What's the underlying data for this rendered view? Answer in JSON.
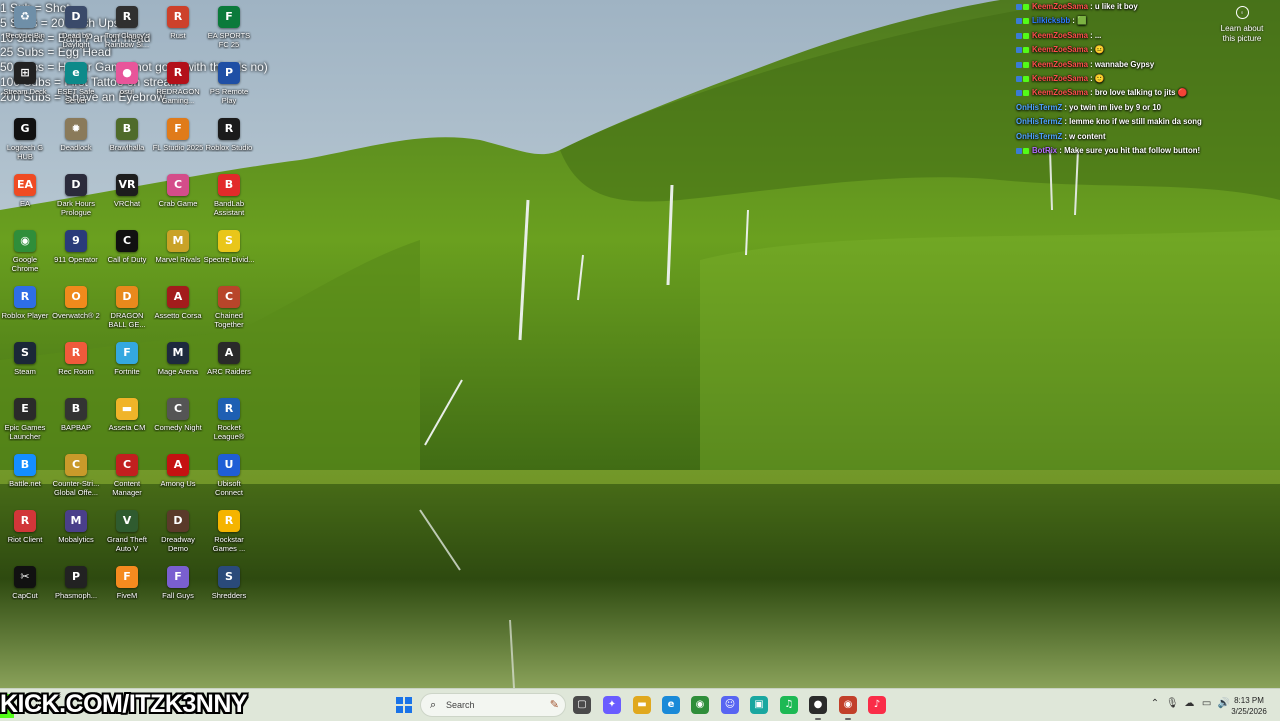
{
  "desktop_icons": [
    {
      "label": "Recycle Bin",
      "glyph": "♻",
      "color": "#6f8fa8",
      "col": 0,
      "row": 0
    },
    {
      "label": "Dead by Daylight",
      "glyph": "D",
      "color": "#3a4a6a",
      "col": 1,
      "row": 0
    },
    {
      "label": "Tom Clancy's Rainbow Si...",
      "glyph": "R",
      "color": "#303030",
      "col": 2,
      "row": 0
    },
    {
      "label": "Rust",
      "glyph": "R",
      "color": "#cd412b",
      "col": 3,
      "row": 0
    },
    {
      "label": "EA SPORTS FC 25",
      "glyph": "F",
      "color": "#0b7a3b",
      "col": 4,
      "row": 0
    },
    {
      "label": "Stream Deck",
      "glyph": "⊞",
      "color": "#222222",
      "col": 0,
      "row": 1
    },
    {
      "label": "ESET Safe Server",
      "glyph": "e",
      "color": "#0d8a8a",
      "col": 1,
      "row": 1
    },
    {
      "label": "osu!",
      "glyph": "●",
      "color": "#e8559a",
      "col": 2,
      "row": 1
    },
    {
      "label": "REDRAGON Gaming...",
      "glyph": "R",
      "color": "#b3101a",
      "col": 3,
      "row": 1
    },
    {
      "label": "PS Remote Play",
      "glyph": "P",
      "color": "#1f4fa5",
      "col": 4,
      "row": 1
    },
    {
      "label": "Logitech G HUB",
      "glyph": "G",
      "color": "#111111",
      "col": 0,
      "row": 2
    },
    {
      "label": "Deadlock",
      "glyph": "✹",
      "color": "#8a7a5a",
      "col": 1,
      "row": 2
    },
    {
      "label": "Brawlhalla",
      "glyph": "B",
      "color": "#4f6b2a",
      "col": 2,
      "row": 2
    },
    {
      "label": "FL Studio 2025",
      "glyph": "F",
      "color": "#e07b1a",
      "col": 3,
      "row": 2
    },
    {
      "label": "Roblox Studio",
      "glyph": "R",
      "color": "#1b1b1b",
      "col": 4,
      "row": 2
    },
    {
      "label": "EA",
      "glyph": "EA",
      "color": "#ef4b23",
      "col": 0,
      "row": 3
    },
    {
      "label": "Dark Hours Prologue",
      "glyph": "D",
      "color": "#2b2b3b",
      "col": 1,
      "row": 3
    },
    {
      "label": "VRChat",
      "glyph": "VR",
      "color": "#1d1d1d",
      "col": 2,
      "row": 3
    },
    {
      "label": "Crab Game",
      "glyph": "C",
      "color": "#d44d8a",
      "col": 3,
      "row": 3
    },
    {
      "label": "BandLab Assistant",
      "glyph": "B",
      "color": "#e22a2a",
      "col": 4,
      "row": 3
    },
    {
      "label": "Google Chrome",
      "glyph": "◉",
      "color": "#2f8e3a",
      "col": 0,
      "row": 4
    },
    {
      "label": "911 Operator",
      "glyph": "9",
      "color": "#2a3b7a",
      "col": 1,
      "row": 4
    },
    {
      "label": "Call of Duty",
      "glyph": "C",
      "color": "#111111",
      "col": 2,
      "row": 4
    },
    {
      "label": "Marvel Rivals",
      "glyph": "M",
      "color": "#c9a227",
      "col": 3,
      "row": 4
    },
    {
      "label": "Spectre Divid...",
      "glyph": "S",
      "color": "#e9c61a",
      "col": 4,
      "row": 4
    },
    {
      "label": "Roblox Player",
      "glyph": "R",
      "color": "#2e6ee6",
      "col": 0,
      "row": 5
    },
    {
      "label": "Overwatch® 2",
      "glyph": "O",
      "color": "#f08a1c",
      "col": 1,
      "row": 5
    },
    {
      "label": "DRAGON BALL GE...",
      "glyph": "D",
      "color": "#e8891c",
      "col": 2,
      "row": 5
    },
    {
      "label": "Assetto Corsa",
      "glyph": "A",
      "color": "#a31c1c",
      "col": 3,
      "row": 5
    },
    {
      "label": "Chained Together",
      "glyph": "C",
      "color": "#b8452a",
      "col": 4,
      "row": 5
    },
    {
      "label": "Steam",
      "glyph": "S",
      "color": "#1b2838",
      "col": 0,
      "row": 6
    },
    {
      "label": "Rec Room",
      "glyph": "R",
      "color": "#f05a3b",
      "col": 1,
      "row": 6
    },
    {
      "label": "Fortnite",
      "glyph": "F",
      "color": "#34a8e0",
      "col": 2,
      "row": 6
    },
    {
      "label": "Mage Arena",
      "glyph": "M",
      "color": "#1e2a3e",
      "col": 3,
      "row": 6
    },
    {
      "label": "ARC Raiders",
      "glyph": "A",
      "color": "#2a2a2a",
      "col": 4,
      "row": 6
    },
    {
      "label": "Epic Games Launcher",
      "glyph": "E",
      "color": "#2a2a2a",
      "col": 0,
      "row": 7
    },
    {
      "label": "BAPBAP",
      "glyph": "B",
      "color": "#333333",
      "col": 1,
      "row": 7
    },
    {
      "label": "Asseta CM",
      "glyph": "▬",
      "color": "#f0b429",
      "col": 2,
      "row": 7
    },
    {
      "label": "Comedy Night",
      "glyph": "C",
      "color": "#555555",
      "col": 3,
      "row": 7
    },
    {
      "label": "Rocket League®",
      "glyph": "R",
      "color": "#1e5fb3",
      "col": 4,
      "row": 7
    },
    {
      "label": "Battle.net",
      "glyph": "B",
      "color": "#148eff",
      "col": 0,
      "row": 8
    },
    {
      "label": "Counter-Stri... Global Offe...",
      "glyph": "C",
      "color": "#c99a2a",
      "col": 1,
      "row": 8
    },
    {
      "label": "Content Manager",
      "glyph": "C",
      "color": "#c21f1f",
      "col": 2,
      "row": 8
    },
    {
      "label": "Among Us",
      "glyph": "A",
      "color": "#c51111",
      "col": 3,
      "row": 8
    },
    {
      "label": "Ubisoft Connect",
      "glyph": "U",
      "color": "#1f5ed6",
      "col": 4,
      "row": 8
    },
    {
      "label": "Riot Client",
      "glyph": "R",
      "color": "#d13639",
      "col": 0,
      "row": 9
    },
    {
      "label": "Mobalytics",
      "glyph": "M",
      "color": "#4a3f8a",
      "col": 1,
      "row": 9
    },
    {
      "label": "Grand Theft Auto V",
      "glyph": "V",
      "color": "#2f5b2f",
      "col": 2,
      "row": 9
    },
    {
      "label": "Dreadway Demo",
      "glyph": "D",
      "color": "#5a3a2a",
      "col": 3,
      "row": 9
    },
    {
      "label": "Rockstar Games ...",
      "glyph": "R",
      "color": "#f5b400",
      "col": 4,
      "row": 9
    },
    {
      "label": "CapCut",
      "glyph": "✂",
      "color": "#111111",
      "col": 0,
      "row": 10
    },
    {
      "label": "Phasmoph...",
      "glyph": "P",
      "color": "#222222",
      "col": 1,
      "row": 10
    },
    {
      "label": "FiveM",
      "glyph": "F",
      "color": "#f58a1f",
      "col": 2,
      "row": 10
    },
    {
      "label": "Fall Guys",
      "glyph": "F",
      "color": "#7a5fd0",
      "col": 3,
      "row": 10
    },
    {
      "label": "Shredders",
      "glyph": "S",
      "color": "#2a4a7a",
      "col": 4,
      "row": 10
    }
  ],
  "sub_goals": [
    "1 Sub = Shot",
    "5 Subs = 20 Push Ups",
    "10 Subs = Bald Part of head",
    "25 Subs = Egg Head",
    "50 Subs = Horror Game (not good with this pls no)",
    "100 Subs = First Tattoo on stream",
    "200 Subs = Shave an Eyebrow"
  ],
  "chat": [
    {
      "user": "KeemZoeSama",
      "user_color": "#ff4d4d",
      "text": "u like it boy",
      "badges": [
        "#3a7bd5",
        "#53fc18"
      ]
    },
    {
      "user": "Lilkicksbb",
      "user_color": "#2f7bff",
      "text": "🟩",
      "badges": [
        "#3a7bd5",
        "#53fc18"
      ]
    },
    {
      "user": "KeemZoeSama",
      "user_color": "#ff4d4d",
      "text": "...",
      "badges": [
        "#3a7bd5",
        "#53fc18"
      ]
    },
    {
      "user": "KeemZoeSama",
      "user_color": "#ff4d4d",
      "text": "😐",
      "badges": [
        "#3a7bd5",
        "#53fc18"
      ]
    },
    {
      "user": "KeemZoeSama",
      "user_color": "#ff4d4d",
      "text": "wannabe Gypsy",
      "badges": [
        "#3a7bd5",
        "#53fc18"
      ]
    },
    {
      "user": "KeemZoeSama",
      "user_color": "#ff4d4d",
      "text": "🙂",
      "badges": [
        "#3a7bd5",
        "#53fc18"
      ]
    },
    {
      "user": "KeemZoeSama",
      "user_color": "#ff4d4d",
      "text": "bro love talking to jits 🔴",
      "badges": [
        "#3a7bd5",
        "#53fc18"
      ]
    },
    {
      "user": "OnHisTermZ",
      "user_color": "#4fa3ff",
      "text": "yo twin im live by 9 or 10",
      "badges": []
    },
    {
      "user": "OnHisTermZ",
      "user_color": "#4fa3ff",
      "text": "lemme kno if we still makin da song",
      "badges": []
    },
    {
      "user": "OnHisTermZ",
      "user_color": "#4fa3ff",
      "text": "w content",
      "badges": []
    },
    {
      "user": "BotRix",
      "user_color": "#b36bff",
      "text": "Make sure you hit that follow button!",
      "badges": [
        "#3a7bd5",
        "#53fc18"
      ]
    }
  ],
  "learn_picture": {
    "icon": "camera-icon",
    "label": "Learn about this picture"
  },
  "stream_url": "KICK.COM/ITZK3NNY",
  "taskbar": {
    "search_placeholder": "Search",
    "pinned": [
      {
        "name": "task-view",
        "glyph": "▢",
        "color": "#4a4a4a"
      },
      {
        "name": "copilot",
        "glyph": "✦",
        "color": "#6a5cff"
      },
      {
        "name": "file-explorer",
        "glyph": "▬",
        "color": "#e0a81e"
      },
      {
        "name": "edge",
        "glyph": "e",
        "color": "#1a8ad8"
      },
      {
        "name": "chrome",
        "glyph": "◉",
        "color": "#2f8e3a"
      },
      {
        "name": "discord",
        "glyph": "☺",
        "color": "#5865f2"
      },
      {
        "name": "app-teal",
        "glyph": "▣",
        "color": "#19a7a0"
      },
      {
        "name": "spotify",
        "glyph": "♫",
        "color": "#1db954"
      },
      {
        "name": "obs",
        "glyph": "●",
        "color": "#2b2b2b"
      },
      {
        "name": "chrome-profile",
        "glyph": "◉",
        "color": "#c2402a"
      },
      {
        "name": "apple-music",
        "glyph": "♪",
        "color": "#fa2d48"
      }
    ],
    "tray_icons": [
      "chevron-up-icon",
      "mic-icon",
      "onedrive-icon",
      "network-icon",
      "volume-icon",
      "battery-icon"
    ],
    "time": "8:13 PM",
    "date": "3/25/2026"
  },
  "colors": {
    "kick_green": "#53fc18",
    "taskbar_bg": "#dfe7d9"
  }
}
